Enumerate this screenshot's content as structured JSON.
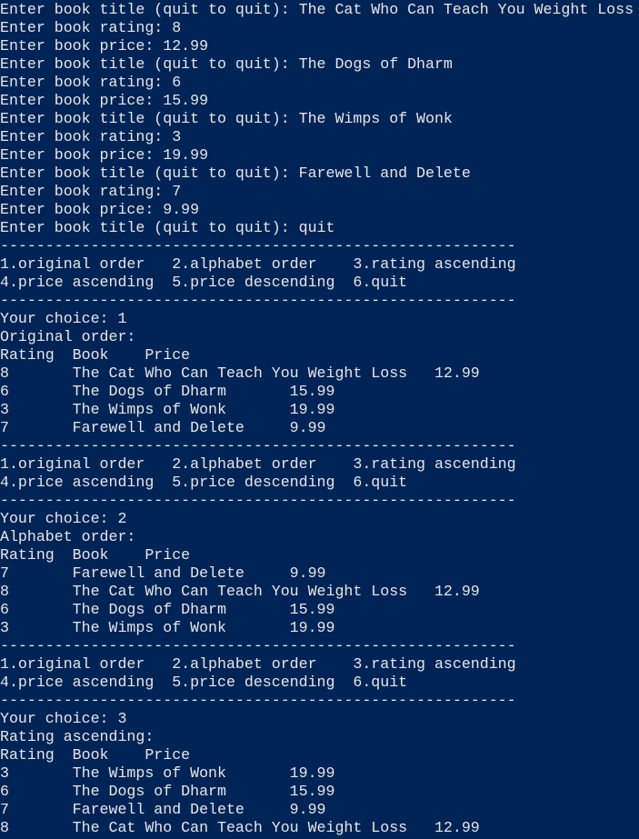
{
  "console": {
    "lines": [
      "Enter book title (quit to quit): The Cat Who Can Teach You Weight Loss",
      "Enter book rating: 8",
      "Enter book price: 12.99",
      "Enter book title (quit to quit): The Dogs of Dharm",
      "Enter book rating: 6",
      "Enter book price: 15.99",
      "Enter book title (quit to quit): The Wimps of Wonk",
      "Enter book rating: 3",
      "Enter book price: 19.99",
      "Enter book title (quit to quit): Farewell and Delete",
      "Enter book rating: 7",
      "Enter book price: 9.99",
      "Enter book title (quit to quit): quit",
      "---------------------------------------------------------",
      "1.original order   2.alphabet order    3.rating ascending",
      "4.price ascending  5.price descending  6.quit",
      "---------------------------------------------------------",
      "Your choice: 1",
      "Original order:",
      "Rating  Book    Price",
      "8       The Cat Who Can Teach You Weight Loss   12.99",
      "6       The Dogs of Dharm       15.99",
      "3       The Wimps of Wonk       19.99",
      "7       Farewell and Delete     9.99",
      "---------------------------------------------------------",
      "1.original order   2.alphabet order    3.rating ascending",
      "4.price ascending  5.price descending  6.quit",
      "---------------------------------------------------------",
      "Your choice: 2",
      "Alphabet order:",
      "Rating  Book    Price",
      "7       Farewell and Delete     9.99",
      "8       The Cat Who Can Teach You Weight Loss   12.99",
      "6       The Dogs of Dharm       15.99",
      "3       The Wimps of Wonk       19.99",
      "---------------------------------------------------------",
      "1.original order   2.alphabet order    3.rating ascending",
      "4.price ascending  5.price descending  6.quit",
      "---------------------------------------------------------",
      "Your choice: 3",
      "Rating ascending:",
      "Rating  Book    Price",
      "3       The Wimps of Wonk       19.99",
      "6       The Dogs of Dharm       15.99",
      "7       Farewell and Delete     9.99",
      "8       The Cat Who Can Teach You Weight Loss   12.99"
    ]
  },
  "colors": {
    "background": "#012456",
    "text": "#e6e6e6"
  }
}
